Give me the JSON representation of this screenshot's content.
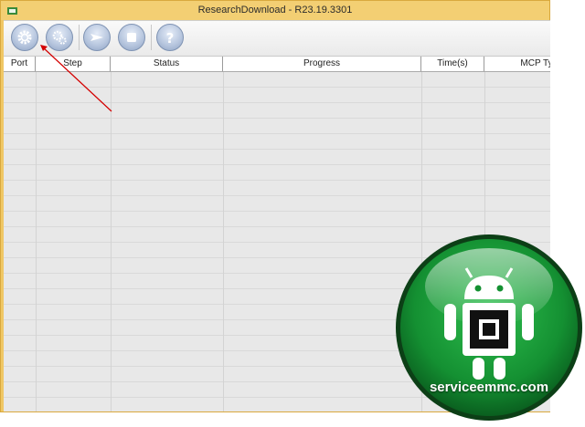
{
  "window": {
    "title": "ResearchDownload - R23.19.3301"
  },
  "toolbar": {
    "buttons": [
      {
        "icon": "gear-icon"
      },
      {
        "icon": "gears-icon"
      },
      {
        "icon": "play-icon"
      },
      {
        "icon": "stop-icon"
      },
      {
        "icon": "help-icon"
      }
    ]
  },
  "grid": {
    "columns": [
      "Port",
      "Step",
      "Status",
      "Progress",
      "Time(s)",
      "MCP Ty"
    ]
  },
  "watermark": {
    "text": "serviceemmc.com"
  },
  "colors": {
    "titlebar": "#f3cf73",
    "annotation_arrow": "#d40000",
    "logo_green": "#1e9a3a"
  }
}
